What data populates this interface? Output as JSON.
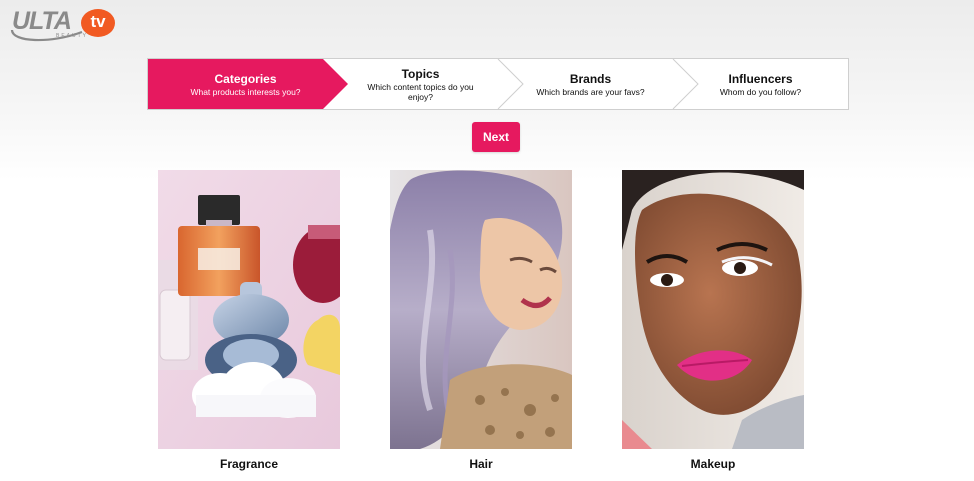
{
  "brand": {
    "name": "ULTA",
    "sub": "BEAUTY",
    "tv": "tv"
  },
  "colors": {
    "accent": "#e6195f",
    "tv_badge": "#f15a22"
  },
  "steps": [
    {
      "title": "Categories",
      "desc": "What products interests you?",
      "active": true
    },
    {
      "title": "Topics",
      "desc": "Which content topics do you enjoy?",
      "active": false
    },
    {
      "title": "Brands",
      "desc": "Which brands are your favs?",
      "active": false
    },
    {
      "title": "Influencers",
      "desc": "Whom do you follow?",
      "active": false
    }
  ],
  "next_label": "Next",
  "categories": [
    {
      "label": "Fragrance",
      "icon": "fragrance-image"
    },
    {
      "label": "Hair",
      "icon": "hair-image"
    },
    {
      "label": "Makeup",
      "icon": "makeup-image"
    }
  ]
}
